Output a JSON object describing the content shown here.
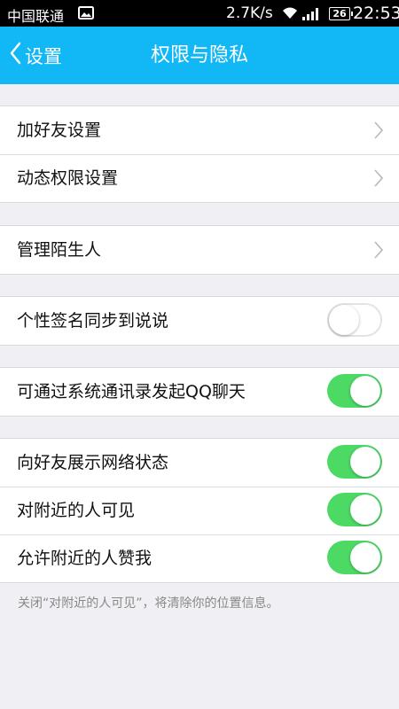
{
  "status_bar": {
    "carrier": "中国联通",
    "speed": "2.7K/s",
    "battery": "26",
    "time": "22:53"
  },
  "nav": {
    "back_label": "设置",
    "title": "权限与隐私"
  },
  "groups": [
    {
      "items": [
        {
          "label": "加好友设置",
          "type": "chevron"
        },
        {
          "label": "动态权限设置",
          "type": "chevron"
        }
      ]
    },
    {
      "items": [
        {
          "label": "管理陌生人",
          "type": "chevron"
        }
      ]
    },
    {
      "items": [
        {
          "label": "个性签名同步到说说",
          "type": "toggle",
          "on": false
        }
      ]
    },
    {
      "items": [
        {
          "label": "可通过系统通讯录发起QQ聊天",
          "type": "toggle",
          "on": true
        }
      ]
    },
    {
      "items": [
        {
          "label": "向好友展示网络状态",
          "type": "toggle",
          "on": true
        },
        {
          "label": "对附近的人可见",
          "type": "toggle",
          "on": true
        },
        {
          "label": "允许附近的人赞我",
          "type": "toggle",
          "on": true
        }
      ]
    }
  ],
  "footnote": "关闭“对附近的人可见”，将清除你的位置信息。",
  "colors": {
    "nav_background": "#12b7f5",
    "toggle_on": "#4cd964",
    "page_background": "#efeff4"
  }
}
